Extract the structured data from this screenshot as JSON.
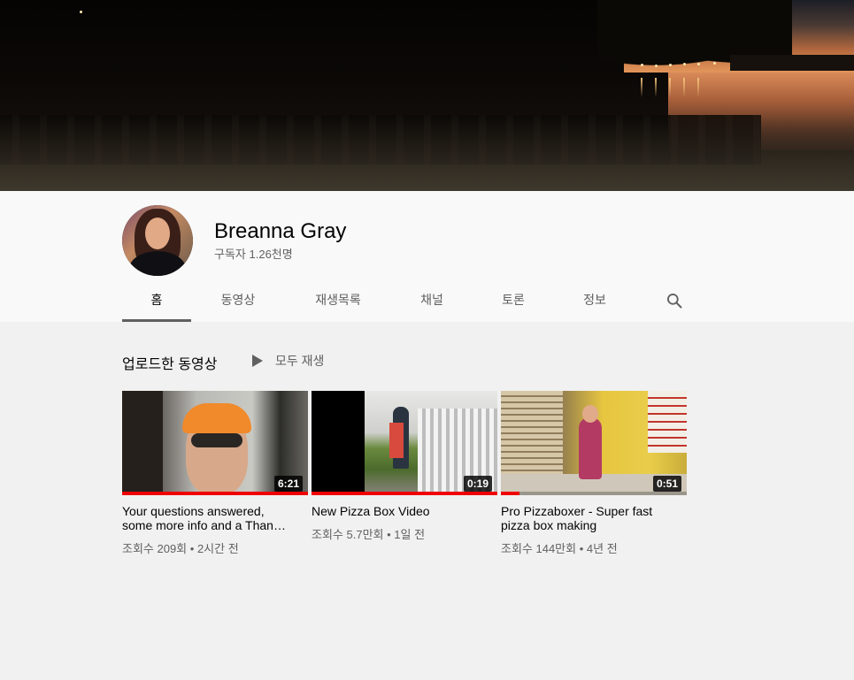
{
  "channel": {
    "name": "Breanna Gray",
    "subscribers": "구독자 1.26천명"
  },
  "tabs": [
    {
      "label": "홈",
      "active": true
    },
    {
      "label": "동영상",
      "active": false
    },
    {
      "label": "재생목록",
      "active": false
    },
    {
      "label": "채널",
      "active": false
    },
    {
      "label": "토론",
      "active": false
    },
    {
      "label": "정보",
      "active": false
    }
  ],
  "search": {
    "icon": "search-icon"
  },
  "uploads": {
    "title": "업로드한 동영상",
    "play_all": "모두 재생",
    "videos": [
      {
        "title": "Your questions answered, some more info and a Than…",
        "duration": "6:21",
        "views": "조회수 209회",
        "age": "2시간 전",
        "watched_fraction": 1.0
      },
      {
        "title": "New Pizza Box Video",
        "duration": "0:19",
        "views": "조회수 5.7만회",
        "age": "1일 전",
        "watched_fraction": 1.0
      },
      {
        "title": "Pro Pizzaboxer - Super fast pizza box making",
        "duration": "0:51",
        "views": "조회수 144만회",
        "age": "4년 전",
        "watched_fraction": 0.1
      }
    ]
  },
  "colors": {
    "accent_red": "#e00000",
    "text_primary": "#030303",
    "text_secondary": "#606060",
    "page_bg": "#f1f1f1",
    "header_bg": "#f9f9f9"
  }
}
